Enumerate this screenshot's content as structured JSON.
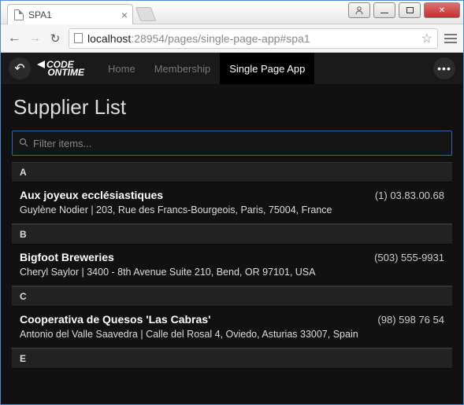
{
  "browser": {
    "tab_title": "SPA1",
    "url_host": "localhost",
    "url_port_path": ":28954/pages/single-page-app#spa1"
  },
  "app": {
    "logo_line1": "CODE",
    "logo_line2": "ONTIME",
    "nav": [
      {
        "label": "Home",
        "active": false
      },
      {
        "label": "Membership",
        "active": false
      },
      {
        "label": "Single Page App",
        "active": true
      }
    ],
    "page_title": "Supplier List",
    "filter_placeholder": "Filter items...",
    "groups": [
      {
        "letter": "A",
        "items": [
          {
            "name": "Aux joyeux ecclésiastiques",
            "phone": "(1) 03.83.00.68",
            "detail": "Guylène Nodier | 203, Rue des Francs-Bourgeois, Paris, 75004, France"
          }
        ]
      },
      {
        "letter": "B",
        "items": [
          {
            "name": "Bigfoot Breweries",
            "phone": "(503) 555-9931",
            "detail": "Cheryl Saylor | 3400 - 8th Avenue Suite 210, Bend, OR 97101, USA"
          }
        ]
      },
      {
        "letter": "C",
        "items": [
          {
            "name": "Cooperativa de Quesos 'Las Cabras'",
            "phone": "(98) 598 76 54",
            "detail": "Antonio del Valle Saavedra | Calle del Rosal 4, Oviedo, Asturias 33007, Spain"
          }
        ]
      },
      {
        "letter": "E",
        "items": []
      }
    ]
  }
}
